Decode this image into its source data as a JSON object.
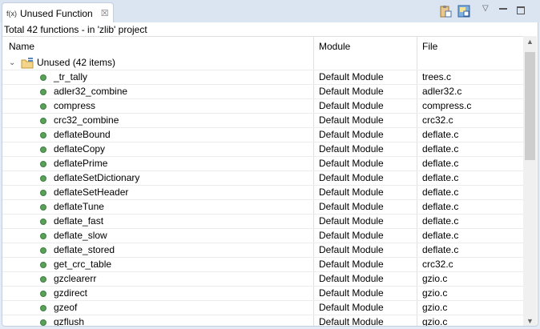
{
  "tab": {
    "icon_text": "f(x)",
    "title": "Unused Function",
    "close": "☒"
  },
  "status": "Total 42 functions - in 'zlib' project",
  "columns": [
    "Name",
    "Module",
    "File"
  ],
  "group": "Unused (42 items)",
  "rows": [
    {
      "name": "_tr_tally",
      "module": "Default Module",
      "file": "trees.c"
    },
    {
      "name": "adler32_combine",
      "module": "Default Module",
      "file": "adler32.c"
    },
    {
      "name": "compress",
      "module": "Default Module",
      "file": "compress.c"
    },
    {
      "name": "crc32_combine",
      "module": "Default Module",
      "file": "crc32.c"
    },
    {
      "name": "deflateBound",
      "module": "Default Module",
      "file": "deflate.c"
    },
    {
      "name": "deflateCopy",
      "module": "Default Module",
      "file": "deflate.c"
    },
    {
      "name": "deflatePrime",
      "module": "Default Module",
      "file": "deflate.c"
    },
    {
      "name": "deflateSetDictionary",
      "module": "Default Module",
      "file": "deflate.c"
    },
    {
      "name": "deflateSetHeader",
      "module": "Default Module",
      "file": "deflate.c"
    },
    {
      "name": "deflateTune",
      "module": "Default Module",
      "file": "deflate.c"
    },
    {
      "name": "deflate_fast",
      "module": "Default Module",
      "file": "deflate.c"
    },
    {
      "name": "deflate_slow",
      "module": "Default Module",
      "file": "deflate.c"
    },
    {
      "name": "deflate_stored",
      "module": "Default Module",
      "file": "deflate.c"
    },
    {
      "name": "get_crc_table",
      "module": "Default Module",
      "file": "crc32.c"
    },
    {
      "name": "gzclearerr",
      "module": "Default Module",
      "file": "gzio.c"
    },
    {
      "name": "gzdirect",
      "module": "Default Module",
      "file": "gzio.c"
    },
    {
      "name": "gzeof",
      "module": "Default Module",
      "file": "gzio.c"
    },
    {
      "name": "gzflush",
      "module": "Default Module",
      "file": "gzio.c"
    }
  ]
}
